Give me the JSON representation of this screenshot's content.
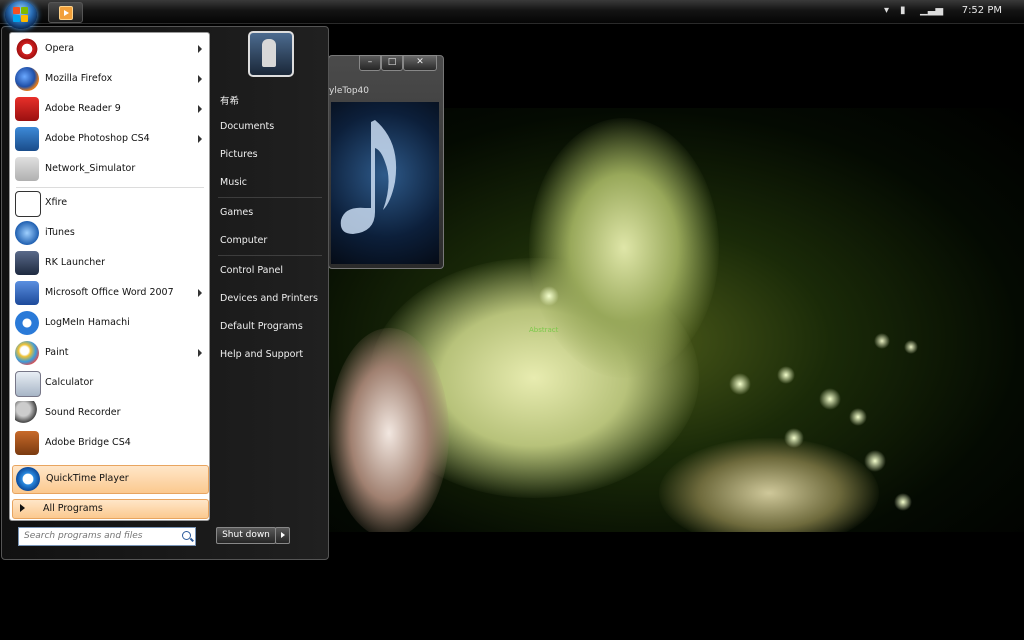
{
  "taskbar": {
    "clock": "7:52 PM",
    "tray_icons": [
      "chevron-up-icon",
      "battery-icon",
      "signal-icon"
    ]
  },
  "media_window": {
    "title_partial": "yleTop40",
    "minimize": "–",
    "maximize": "□",
    "close": "✕"
  },
  "start_menu": {
    "programs": [
      {
        "label": "Opera",
        "icon": "opera-icon",
        "arrow": true
      },
      {
        "label": "Mozilla Firefox",
        "icon": "firefox-icon",
        "arrow": true
      },
      {
        "label": "Adobe Reader 9",
        "icon": "adobe-reader-icon",
        "arrow": true
      },
      {
        "label": "Adobe Photoshop CS4",
        "icon": "photoshop-icon",
        "arrow": true
      },
      {
        "label": "Network_Simulator",
        "icon": "network-simulator-icon",
        "arrow": false
      },
      {
        "label": "Xfire",
        "icon": "xfire-icon",
        "arrow": false
      },
      {
        "label": "iTunes",
        "icon": "itunes-icon",
        "arrow": false
      },
      {
        "label": "RK Launcher",
        "icon": "rk-launcher-icon",
        "arrow": false
      },
      {
        "label": "Microsoft Office Word 2007",
        "icon": "word-icon",
        "arrow": true
      },
      {
        "label": "LogMeIn Hamachi",
        "icon": "hamachi-icon",
        "arrow": false
      },
      {
        "label": "Paint",
        "icon": "paint-icon",
        "arrow": true
      },
      {
        "label": "Calculator",
        "icon": "calculator-icon",
        "arrow": false
      },
      {
        "label": "Sound Recorder",
        "icon": "microphone-icon",
        "arrow": false
      },
      {
        "label": "Adobe Bridge CS4",
        "icon": "bridge-icon",
        "arrow": false
      },
      {
        "label": "QuickTime Player",
        "icon": "quicktime-icon",
        "arrow": false
      }
    ],
    "all_programs": "All Programs",
    "search_placeholder": "Search programs and files",
    "right_items": [
      "有希",
      "Documents",
      "Pictures",
      "Music",
      "Games",
      "Computer",
      "Control Panel",
      "Devices and Printers",
      "Default Programs",
      "Help and Support"
    ],
    "shutdown": "Shut down"
  },
  "wallpaper": {
    "caption": "Abstract"
  }
}
